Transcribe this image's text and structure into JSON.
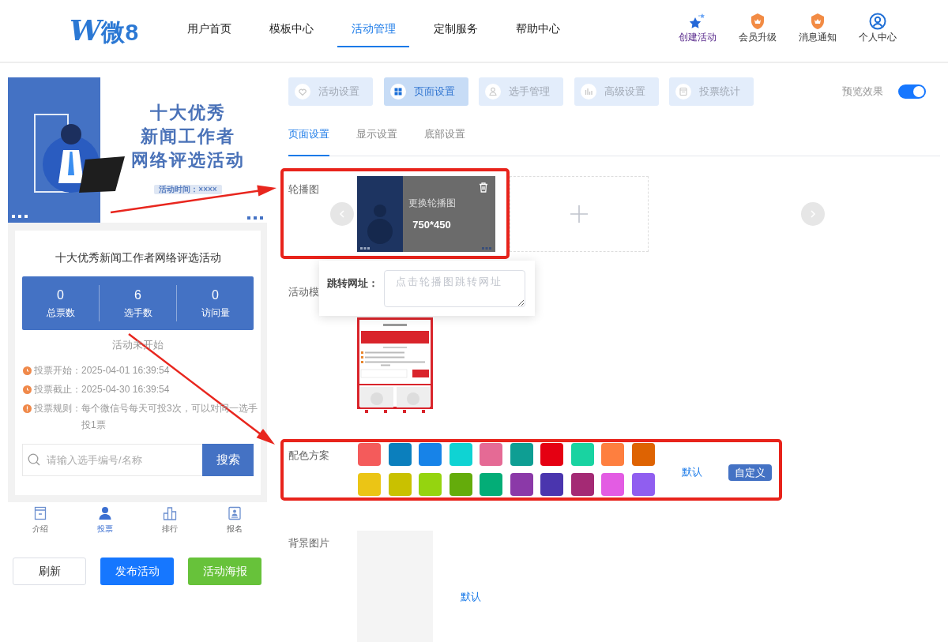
{
  "header": {
    "logo": {
      "mark": "W",
      "text": "微8"
    },
    "nav": [
      {
        "label": "用户首页",
        "selected": false
      },
      {
        "label": "模板中心",
        "selected": false
      },
      {
        "label": "活动管理",
        "selected": true
      },
      {
        "label": "定制服务",
        "selected": false
      },
      {
        "label": "帮助中心",
        "selected": false
      }
    ],
    "actions": [
      {
        "label": "创建活动",
        "kind": "create",
        "highlighted": true
      },
      {
        "label": "会员升级",
        "kind": "upgrade",
        "highlighted": false
      },
      {
        "label": "消息通知",
        "kind": "notice",
        "highlighted": false
      },
      {
        "label": "个人中心",
        "kind": "profile",
        "highlighted": false
      }
    ]
  },
  "preview": {
    "banner": {
      "title_lines": [
        "十大优秀",
        "新闻工作者",
        "网络评选活动"
      ],
      "time_tag": "活动时间：××××"
    },
    "title": "十大优秀新闻工作者网络评选活动",
    "stats": [
      {
        "value": "0",
        "label": "总票数"
      },
      {
        "value": "6",
        "label": "选手数"
      },
      {
        "value": "0",
        "label": "访问量"
      }
    ],
    "status": "活动未开始",
    "info": [
      {
        "label": "投票开始：",
        "value": "2025-04-01 16:39:54",
        "kind": "time"
      },
      {
        "label": "投票截止：",
        "value": "2025-04-30 16:39:54",
        "kind": "time"
      },
      {
        "label": "投票规则：",
        "value": "每个微信号每天可投3次，可以对同一选手投1票",
        "kind": "rule"
      }
    ],
    "search": {
      "placeholder": "请输入选手编号/名称",
      "button": "搜索"
    },
    "tabbar": [
      {
        "label": "介绍",
        "kind": "intro",
        "selected": false
      },
      {
        "label": "投票",
        "kind": "vote",
        "selected": true
      },
      {
        "label": "排行",
        "kind": "rank",
        "selected": false
      },
      {
        "label": "报名",
        "kind": "signup",
        "selected": false
      }
    ],
    "buttons": [
      {
        "label": "刷新",
        "kind": "plain"
      },
      {
        "label": "发布活动",
        "kind": "primary"
      },
      {
        "label": "活动海报",
        "kind": "success"
      }
    ]
  },
  "settings": {
    "steps": [
      {
        "label": "活动设置",
        "kind": "heart",
        "selected": false
      },
      {
        "label": "页面设置",
        "kind": "grid",
        "selected": true
      },
      {
        "label": "选手管理",
        "kind": "person",
        "selected": false
      },
      {
        "label": "高级设置",
        "kind": "chart",
        "selected": false
      },
      {
        "label": "投票统计",
        "kind": "list",
        "selected": false
      }
    ],
    "preview_toggle": {
      "label": "预览效果",
      "on": true
    },
    "subtabs": [
      {
        "label": "页面设置",
        "selected": true
      },
      {
        "label": "显示设置",
        "selected": false
      },
      {
        "label": "底部设置",
        "selected": false
      }
    ],
    "carousel": {
      "label": "轮播图",
      "replace_label": "更换轮播图",
      "size": "750*450"
    },
    "link_popup": {
      "label": "跳转网址：",
      "placeholder": "点击轮播图跳转网址"
    },
    "template": {
      "label": "活动模"
    },
    "color_scheme": {
      "label": "配色方案",
      "swatches": [
        {
          "color": "#f45b5b"
        },
        {
          "color": "#0b7fbd"
        },
        {
          "color": "#1783e8"
        },
        {
          "color": "#0fd3d3"
        },
        {
          "color": "#e56a95"
        },
        {
          "color": "#0e9e93"
        },
        {
          "color": "#e50012"
        },
        {
          "color": "#19d3a1"
        },
        {
          "color": "#fe7f3f"
        },
        {
          "color": "#de6302"
        },
        {
          "color": "#ebc515"
        },
        {
          "color": "#c9c100"
        },
        {
          "color": "#95d40f"
        },
        {
          "color": "#64ac0b"
        },
        {
          "color": "#03ad77"
        },
        {
          "color": "#8b39a8"
        },
        {
          "color": "#4a35ae"
        },
        {
          "color": "#a42a74"
        },
        {
          "color": "#e35ce3"
        },
        {
          "color": "#905ef0"
        }
      ],
      "default_link": "默认",
      "custom_button": "自定义"
    },
    "background": {
      "label": "背景图片",
      "default_link": "默认"
    }
  }
}
